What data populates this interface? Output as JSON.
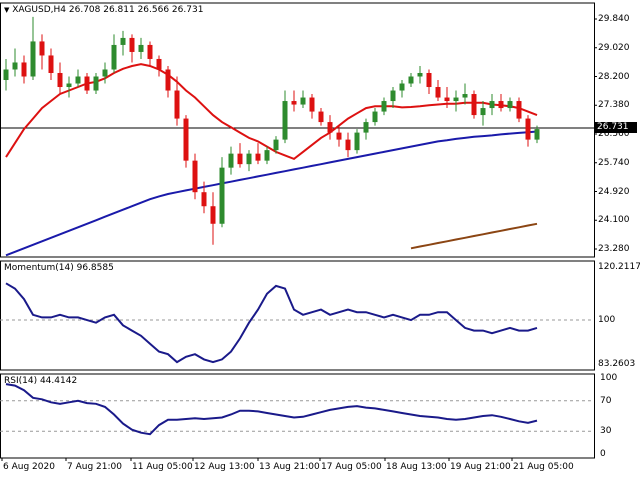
{
  "header": {
    "symbol": "XAGUSD,H4",
    "ohlc": "26.708 26.811 26.566 26.731"
  },
  "price_axis": {
    "ticks": [
      "29.840",
      "29.020",
      "28.200",
      "27.380",
      "26.560",
      "25.740",
      "24.920",
      "24.100",
      "23.280"
    ],
    "current": "26.731"
  },
  "momentum": {
    "label": "Momentum(14) 96.8585",
    "ticks": [
      "120.2117",
      "100",
      "83.2603"
    ]
  },
  "rsi": {
    "label": "RSI(14) 44.4142",
    "ticks": [
      "100",
      "70",
      "30",
      "0"
    ]
  },
  "time_axis": [
    "6 Aug 2020",
    "7 Aug 21:00",
    "11 Aug 05:00",
    "12 Aug 13:00",
    "13 Aug 21:00",
    "17 Aug 05:00",
    "18 Aug 13:00",
    "19 Aug 21:00",
    "21 Aug 05:00"
  ],
  "colors": {
    "bull": "#2e8b2e",
    "bear": "#dd1111",
    "ma_fast": "#dd1111",
    "ma_slow": "#1a1aaa",
    "ma_long": "#8b4513",
    "indicator": "#1a1a8a"
  },
  "chart_data": [
    {
      "type": "candlestick",
      "title": "XAGUSD,H4",
      "ylim": [
        23.28,
        29.84
      ],
      "candles": [
        [
          28.1,
          28.7,
          27.8,
          28.4
        ],
        [
          28.4,
          29.0,
          28.2,
          28.6
        ],
        [
          28.6,
          28.8,
          28.0,
          28.2
        ],
        [
          28.2,
          29.9,
          28.1,
          29.2
        ],
        [
          29.2,
          29.4,
          28.4,
          28.8
        ],
        [
          28.8,
          29.0,
          28.1,
          28.3
        ],
        [
          28.3,
          28.6,
          27.7,
          27.9
        ],
        [
          27.9,
          28.2,
          27.6,
          28.0
        ],
        [
          28.0,
          28.4,
          27.9,
          28.2
        ],
        [
          28.2,
          28.3,
          27.7,
          27.8
        ],
        [
          27.8,
          28.3,
          27.7,
          28.2
        ],
        [
          28.2,
          28.6,
          28.0,
          28.4
        ],
        [
          28.4,
          29.4,
          28.3,
          29.1
        ],
        [
          29.1,
          29.5,
          28.8,
          29.3
        ],
        [
          29.3,
          29.4,
          28.6,
          28.9
        ],
        [
          28.9,
          29.3,
          28.7,
          29.1
        ],
        [
          29.1,
          29.2,
          28.5,
          28.7
        ],
        [
          28.7,
          28.8,
          28.2,
          28.4
        ],
        [
          28.4,
          28.5,
          27.6,
          27.8
        ],
        [
          27.8,
          28.2,
          26.8,
          27.0
        ],
        [
          27.0,
          27.1,
          25.6,
          25.8
        ],
        [
          25.8,
          26.0,
          24.7,
          24.9
        ],
        [
          24.9,
          25.2,
          24.3,
          24.5
        ],
        [
          24.5,
          24.9,
          23.4,
          24.0
        ],
        [
          24.0,
          25.9,
          23.9,
          25.6
        ],
        [
          25.6,
          26.2,
          25.4,
          26.0
        ],
        [
          26.0,
          26.3,
          25.6,
          25.7
        ],
        [
          25.7,
          26.1,
          25.5,
          26.0
        ],
        [
          26.0,
          26.3,
          25.7,
          25.8
        ],
        [
          25.8,
          26.2,
          25.7,
          26.1
        ],
        [
          26.1,
          26.5,
          26.0,
          26.4
        ],
        [
          26.4,
          27.8,
          26.3,
          27.5
        ],
        [
          27.5,
          27.8,
          27.2,
          27.4
        ],
        [
          27.4,
          27.8,
          27.3,
          27.6
        ],
        [
          27.6,
          27.7,
          27.0,
          27.2
        ],
        [
          27.2,
          27.3,
          26.8,
          26.9
        ],
        [
          26.9,
          27.1,
          26.4,
          26.6
        ],
        [
          26.6,
          26.8,
          26.2,
          26.4
        ],
        [
          26.4,
          26.6,
          25.9,
          26.1
        ],
        [
          26.1,
          26.7,
          26.0,
          26.6
        ],
        [
          26.6,
          27.0,
          26.4,
          26.9
        ],
        [
          26.9,
          27.3,
          26.8,
          27.2
        ],
        [
          27.2,
          27.6,
          27.1,
          27.5
        ],
        [
          27.5,
          27.9,
          27.3,
          27.8
        ],
        [
          27.8,
          28.1,
          27.6,
          28.0
        ],
        [
          28.0,
          28.3,
          27.9,
          28.2
        ],
        [
          28.2,
          28.5,
          28.0,
          28.3
        ],
        [
          28.3,
          28.4,
          27.7,
          27.9
        ],
        [
          27.9,
          28.1,
          27.5,
          27.6
        ],
        [
          27.6,
          27.9,
          27.3,
          27.5
        ],
        [
          27.5,
          27.8,
          27.2,
          27.6
        ],
        [
          27.6,
          28.0,
          27.4,
          27.7
        ],
        [
          27.7,
          27.8,
          27.0,
          27.1
        ],
        [
          27.1,
          27.5,
          26.8,
          27.3
        ],
        [
          27.3,
          27.7,
          27.1,
          27.5
        ],
        [
          27.5,
          27.7,
          27.2,
          27.3
        ],
        [
          27.3,
          27.6,
          27.2,
          27.5
        ],
        [
          27.5,
          27.6,
          26.9,
          27.0
        ],
        [
          27.0,
          27.1,
          26.2,
          26.4
        ],
        [
          26.4,
          26.8,
          26.3,
          26.7
        ]
      ],
      "moving_averages": [
        {
          "color": "#dd1111",
          "values": [
            25.9,
            26.3,
            26.7,
            27.0,
            27.3,
            27.5,
            27.7,
            27.8,
            27.9,
            28.0,
            28.05,
            28.15,
            28.3,
            28.42,
            28.5,
            28.55,
            28.5,
            28.4,
            28.25,
            28.05,
            27.8,
            27.6,
            27.35,
            27.1,
            26.9,
            26.75,
            26.6,
            26.45,
            26.35,
            26.2,
            26.05,
            25.95,
            25.85,
            26.05,
            26.25,
            26.45,
            26.6,
            26.8,
            27.0,
            27.15,
            27.3,
            27.35,
            27.35,
            27.35,
            27.32,
            27.33,
            27.35,
            27.38,
            27.4,
            27.42,
            27.42,
            27.45,
            27.45,
            27.45,
            27.4,
            27.38,
            27.35,
            27.3,
            27.2,
            27.1
          ]
        },
        {
          "color": "#1a1aaa",
          "values": [
            23.1,
            23.2,
            23.3,
            23.4,
            23.5,
            23.6,
            23.7,
            23.8,
            23.9,
            24.0,
            24.1,
            24.2,
            24.3,
            24.4,
            24.5,
            24.6,
            24.7,
            24.78,
            24.85,
            24.9,
            24.95,
            25.0,
            25.05,
            25.1,
            25.15,
            25.2,
            25.25,
            25.3,
            25.35,
            25.4,
            25.45,
            25.5,
            25.55,
            25.6,
            25.65,
            25.7,
            25.75,
            25.8,
            25.85,
            25.9,
            25.95,
            26.0,
            26.05,
            26.1,
            26.15,
            26.2,
            26.25,
            26.3,
            26.35,
            26.38,
            26.42,
            26.45,
            26.48,
            26.5,
            26.52,
            26.55,
            26.57,
            26.59,
            26.61,
            26.63
          ]
        },
        {
          "color": "#8b4513",
          "values": [
            null,
            null,
            null,
            null,
            null,
            null,
            null,
            null,
            null,
            null,
            null,
            null,
            null,
            null,
            null,
            null,
            null,
            null,
            null,
            null,
            null,
            null,
            null,
            null,
            null,
            null,
            null,
            null,
            null,
            null,
            null,
            null,
            null,
            null,
            null,
            null,
            null,
            null,
            null,
            null,
            null,
            null,
            null,
            null,
            null,
            23.3,
            23.35,
            23.4,
            23.45,
            23.5,
            23.55,
            23.6,
            23.65,
            23.7,
            23.75,
            23.8,
            23.85,
            23.9,
            23.95,
            24.0
          ]
        }
      ]
    },
    {
      "type": "line",
      "title": "Momentum(14) 96.8585",
      "ylim": [
        83.2603,
        120.2117
      ],
      "values": [
        114,
        112,
        108,
        102,
        101,
        101,
        102,
        101,
        101,
        100,
        99,
        101,
        102,
        98,
        96,
        94,
        91,
        88,
        87,
        84,
        86,
        87,
        85,
        84,
        85,
        88,
        93,
        99,
        104,
        110,
        113,
        112,
        104,
        102,
        103,
        104,
        102,
        103,
        104,
        103,
        103,
        102,
        101,
        102,
        101,
        100,
        102,
        102,
        103,
        103,
        100,
        97,
        96,
        96,
        95,
        96,
        97,
        96,
        96,
        97
      ]
    },
    {
      "type": "line",
      "title": "RSI(14) 44.4142",
      "ylim": [
        0,
        100
      ],
      "values": [
        92,
        90,
        84,
        74,
        72,
        68,
        66,
        68,
        70,
        67,
        66,
        62,
        52,
        40,
        32,
        28,
        26,
        38,
        45,
        45,
        46,
        47,
        46,
        47,
        48,
        52,
        57,
        57,
        56,
        54,
        52,
        50,
        48,
        49,
        52,
        55,
        58,
        60,
        62,
        63,
        61,
        60,
        58,
        56,
        54,
        52,
        50,
        49,
        48,
        46,
        45,
        46,
        48,
        50,
        51,
        49,
        46,
        43,
        41,
        44
      ]
    }
  ]
}
